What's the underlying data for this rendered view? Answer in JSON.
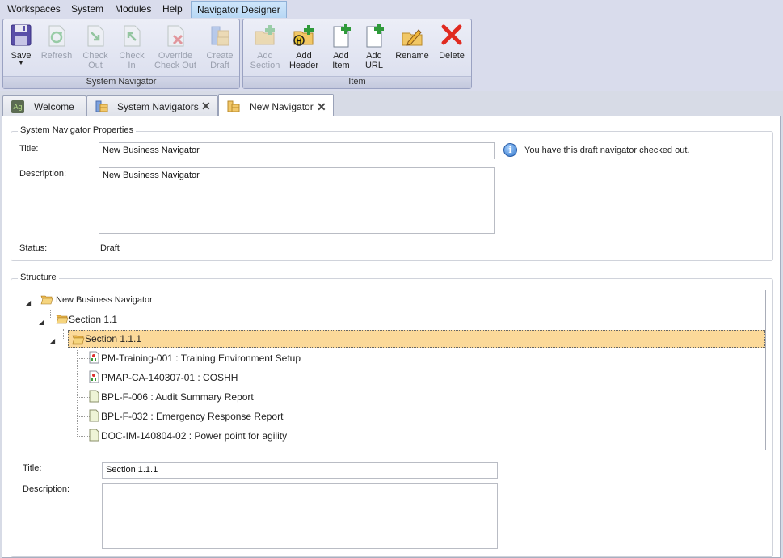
{
  "menu": {
    "items": [
      "Workspaces",
      "System",
      "Modules",
      "Help"
    ],
    "active": "Navigator Designer"
  },
  "ribbon": {
    "group1": {
      "label": "System Navigator",
      "save": "Save",
      "refresh": "Refresh",
      "check_out_1": "Check",
      "check_out_2": "Out",
      "check_in_1": "Check",
      "check_in_2": "In",
      "override_1": "Override",
      "override_2": "Check Out",
      "create_draft_1": "Create",
      "create_draft_2": "Draft"
    },
    "group2": {
      "label": "Item",
      "add_section_1": "Add",
      "add_section_2": "Section",
      "add_header_1": "Add",
      "add_header_2": "Header",
      "add_item_1": "Add",
      "add_item_2": "Item",
      "add_url_1": "Add",
      "add_url_2": "URL",
      "rename": "Rename",
      "delete": "Delete"
    }
  },
  "tabs": [
    {
      "label": "Welcome",
      "icon": "app-icon",
      "closable": false
    },
    {
      "label": "System Navigators",
      "icon": "navigator-icon",
      "closable": true
    },
    {
      "label": "New Navigator",
      "icon": "navigator-icon",
      "closable": true,
      "active": true
    }
  ],
  "properties": {
    "legend": "System Navigator Properties",
    "title_label": "Title:",
    "title_value": "New Business Navigator",
    "info_message": "You have this draft navigator checked out.",
    "description_label": "Description:",
    "description_value": "New Business Navigator",
    "status_label": "Status:",
    "status_value": "Draft"
  },
  "structure": {
    "legend": "Structure",
    "tree": [
      {
        "label": "New Business Navigator",
        "type": "folder-open",
        "level": 0
      },
      {
        "label": "Section 1.1",
        "type": "folder-open",
        "level": 1
      },
      {
        "label": "Section 1.1.1",
        "type": "folder-open",
        "level": 2,
        "selected": true
      },
      {
        "label": "PM-Training-001 : Training Environment Setup",
        "type": "procedure-doc",
        "level": 3
      },
      {
        "label": "PMAP-CA-140307-01 : COSHH",
        "type": "procedure-doc",
        "level": 3
      },
      {
        "label": "BPL-F-006 : Audit Summary Report",
        "type": "form-doc",
        "level": 3
      },
      {
        "label": "BPL-F-032 : Emergency Response Report",
        "type": "form-doc",
        "level": 3
      },
      {
        "label": "DOC-IM-140804-02 : Power point for agility",
        "type": "form-doc",
        "level": 3
      }
    ],
    "item_title_label": "Title:",
    "item_title_value": "Section 1.1.1",
    "item_description_label": "Description:",
    "item_description_value": ""
  }
}
